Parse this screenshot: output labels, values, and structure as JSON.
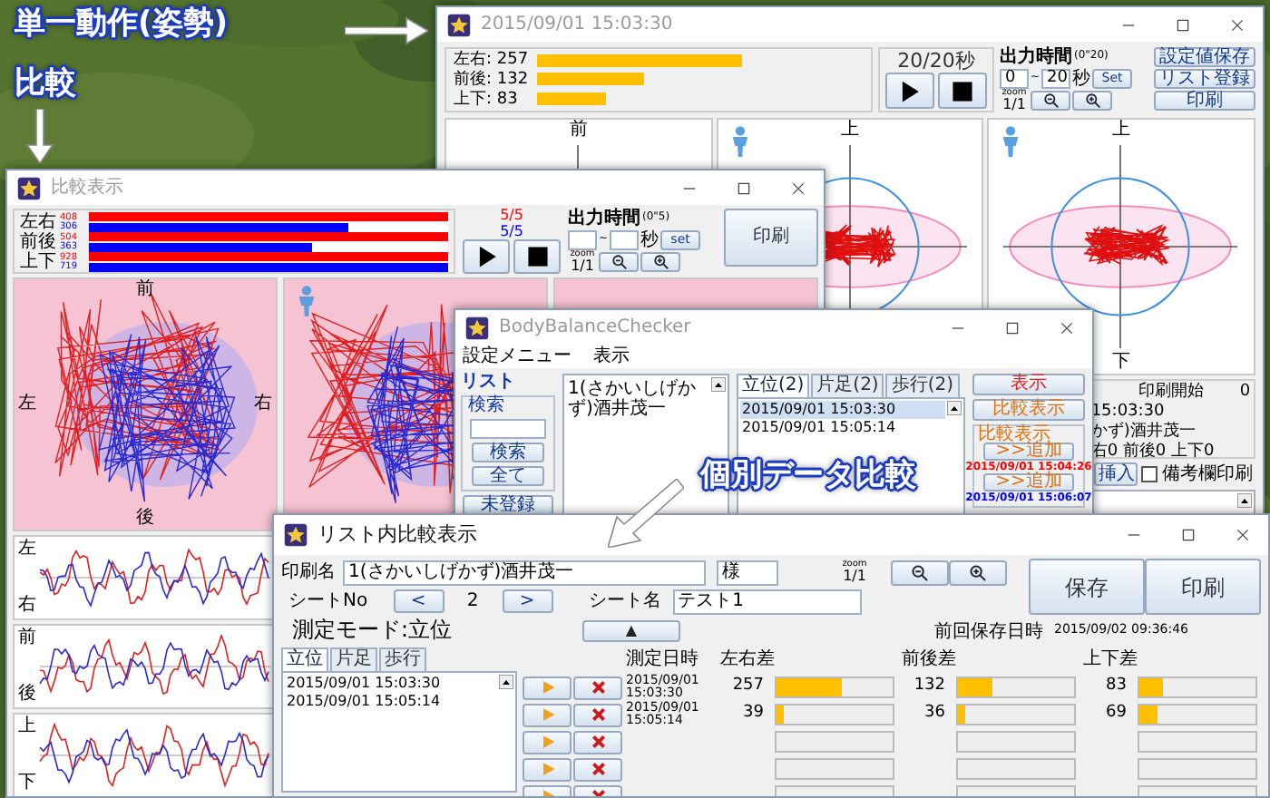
{
  "callouts": [
    {
      "text": "単一動作(姿勢)",
      "kind": "right"
    },
    {
      "text": "比較",
      "kind": "down"
    },
    {
      "text": "個別データ比較",
      "kind": "down-left"
    }
  ],
  "single_window": {
    "title": "2015/09/01 15:03:30",
    "axes": [
      {
        "label": "左右: 257"
      },
      {
        "label": "前後: 132"
      },
      {
        "label": "上下: 83"
      }
    ],
    "time": "20/20秒",
    "output_time": {
      "label": "出力時間",
      "range": "(0\"20)",
      "from": "0",
      "sep": "~",
      "to": "20",
      "unit": "秒",
      "set": "Set"
    },
    "zoom": {
      "label": "zoom",
      "value": "1/1"
    },
    "buttons": [
      "設定値保存",
      "リスト登録",
      "印刷"
    ],
    "plots": [
      {
        "top": "前",
        "figure": false
      },
      {
        "top": "上",
        "figure": true
      },
      {
        "top": "上",
        "bottom": "下",
        "figure": true
      }
    ],
    "info": {
      "label": "印刷開始",
      "value": "0",
      "lines": [
        "15:03:30",
        "かず)酒井茂一",
        "右0 前後0 上下0"
      ]
    },
    "insert": "挿入",
    "remark": {
      "label": "備考欄印刷",
      "checked": false
    }
  },
  "compare_window": {
    "title": "比較表示",
    "axes": [
      {
        "label": "左右",
        "series": [
          {
            "value": "408",
            "level": 1,
            "color": "#ff0000"
          },
          {
            "value": "306",
            "level": 0.72,
            "color": "#0000ff"
          }
        ]
      },
      {
        "label": "前後",
        "series": [
          {
            "value": "504",
            "level": 1,
            "color": "#ff0000"
          },
          {
            "value": "363",
            "level": 0.62,
            "color": "#0000ff"
          }
        ]
      },
      {
        "label": "上下",
        "series": [
          {
            "value": "928",
            "level": 1,
            "color": "#ff0000"
          },
          {
            "value": "719",
            "level": 1,
            "color": "#0000ff"
          }
        ]
      }
    ],
    "counters": [
      {
        "text": "5/5",
        "color": "#ff0000"
      },
      {
        "text": "5/5",
        "color": "#0000ff"
      }
    ],
    "output_time": {
      "label": "出力時間",
      "range": "(0\"5)",
      "sep": "~",
      "unit": "秒",
      "set": "set"
    },
    "zoom": {
      "label": "zoom",
      "value": "1/1"
    },
    "print": "印刷",
    "plots": [
      {
        "top": "前",
        "left": "左",
        "right": "右",
        "bottom": "後",
        "figure": false
      },
      {
        "figure": true
      },
      {
        "figure": false
      }
    ],
    "charts": [
      {
        "top": "左",
        "bottom": "右"
      },
      {
        "top": "前",
        "bottom": "後"
      },
      {
        "top": "上",
        "bottom": "下"
      }
    ]
  },
  "checker_window": {
    "title": "BodyBalanceChecker",
    "menu": [
      "設定メニュー",
      "表示"
    ],
    "list_label": "リスト",
    "search": {
      "label": "検索",
      "buttons": [
        "検索",
        "全て"
      ]
    },
    "unregistered": "未登録",
    "persons": [
      "1(さかいしげかず)酒井茂一"
    ],
    "tabs": [
      {
        "label": "立位(2)",
        "selected": true
      },
      {
        "label": "片足(2)",
        "selected": false
      },
      {
        "label": "歩行(2)",
        "selected": false
      }
    ],
    "records": [
      {
        "text": "2015/09/01 15:03:30",
        "selected": true
      },
      {
        "text": "2015/09/01 15:05:14",
        "selected": false
      }
    ],
    "show": "表示",
    "compare": "比較表示",
    "compare_group": {
      "label": "比較表示",
      "slots": [
        {
          "add": ">>追加",
          "date": "2015/09/01 15:04:26",
          "color": "#ff0000"
        },
        {
          "add": ">>追加",
          "date": "2015/09/01 15:06:07",
          "color": "#0000ff"
        }
      ]
    }
  },
  "list_compare_window": {
    "title": "リスト内比較表示",
    "print_name": {
      "label": "印刷名",
      "value": "1(さかいしげかず)酒井茂一",
      "suffix": "様"
    },
    "zoom": {
      "label": "zoom",
      "value": "1/1"
    },
    "buttons": [
      "保存",
      "印刷"
    ],
    "sheet_no": {
      "label": "シートNo",
      "prev": "<",
      "value": "2",
      "next": ">"
    },
    "sheet_name": {
      "label": "シート名",
      "value": "テスト1"
    },
    "collapse": "▲",
    "last_saved": {
      "label": "前回保存日時",
      "value": "2015/09/02 09:36:46"
    },
    "mode": "測定モード:立位",
    "tabs": [
      {
        "label": "立位",
        "selected": true
      },
      {
        "label": "片足",
        "selected": false
      },
      {
        "label": "歩行",
        "selected": false
      }
    ],
    "records": [
      "2015/09/01 15:03:30",
      "2015/09/01 15:05:14"
    ],
    "columns": [
      "測定日時",
      "左右差",
      "前後差",
      "上下差"
    ],
    "rows": [
      {
        "kind": "record",
        "date": "2015/09/01 15:03:30",
        "values": [
          {
            "value": "257",
            "level": 0.57
          },
          {
            "value": "132",
            "level": 0.29
          },
          {
            "value": "83",
            "level": 0.2
          }
        ]
      },
      {
        "kind": "record",
        "date": "2015/09/01 15:05:14",
        "values": [
          {
            "value": "39",
            "level": 0.06
          },
          {
            "value": "36",
            "level": 0.06
          },
          {
            "value": "69",
            "level": 0.15
          }
        ]
      },
      {
        "kind": "blank"
      },
      {
        "kind": "blank"
      },
      {
        "kind": "blank"
      }
    ]
  }
}
